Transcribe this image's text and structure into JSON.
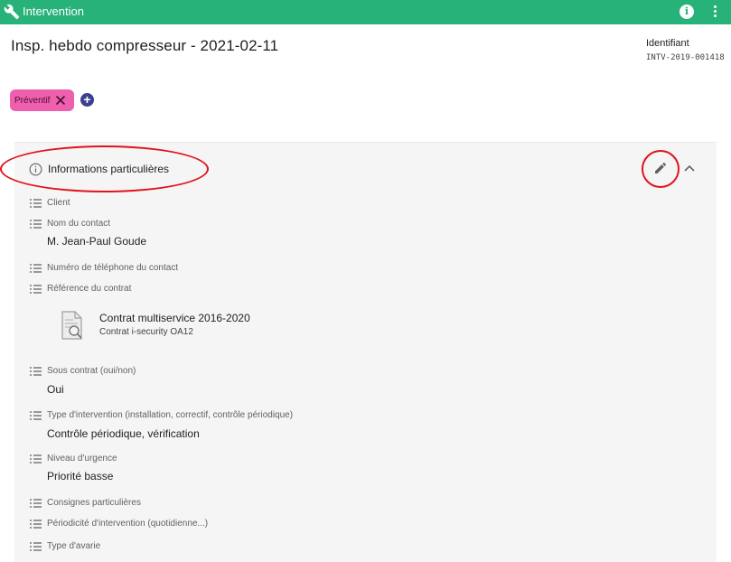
{
  "topbar": {
    "title": "Intervention",
    "icons": [
      "wrench-icon",
      "info-icon",
      "more-vert-icon"
    ],
    "info_glyph": "i"
  },
  "page": {
    "title": "Insp. hebdo compresseur - 2021-02-11",
    "identifier_label": "Identifiant",
    "identifier_value": "INTV-2019-001418"
  },
  "tags": {
    "items": [
      {
        "label": "Préventif",
        "color": "#ee5fae"
      }
    ],
    "add_glyph": "+"
  },
  "panel": {
    "header": "Informations particulières",
    "fields": [
      {
        "label": "Client",
        "value": ""
      },
      {
        "label": "Nom du contact",
        "value": "M. Jean-Paul Goude"
      },
      {
        "label": "Numéro de téléphone du contact",
        "value": ""
      },
      {
        "label": "Référence du contrat",
        "value": ""
      },
      {
        "label": "Sous contrat (oui/non)",
        "value": "Oui"
      },
      {
        "label": "Type d'intervention (installation, correctif, contrôle périodique)",
        "value": "Contrôle périodique, vérification"
      },
      {
        "label": "Niveau d'urgence",
        "value": "Priorité basse"
      },
      {
        "label": "Consignes particulières",
        "value": ""
      },
      {
        "label": "Périodicité d'intervention (quotidienne...)",
        "value": ""
      },
      {
        "label": "Type d'avarie",
        "value": ""
      }
    ],
    "contract": {
      "title": "Contrat multiservice 2016-2020",
      "subtitle": "Contrat i-security OA12"
    }
  },
  "colors": {
    "header_green": "#27b27a",
    "tag_pink": "#ee5fae",
    "add_button": "#3d3f8f",
    "annotation_red": "#e0131b",
    "panel_bg": "#f5f5f5"
  }
}
